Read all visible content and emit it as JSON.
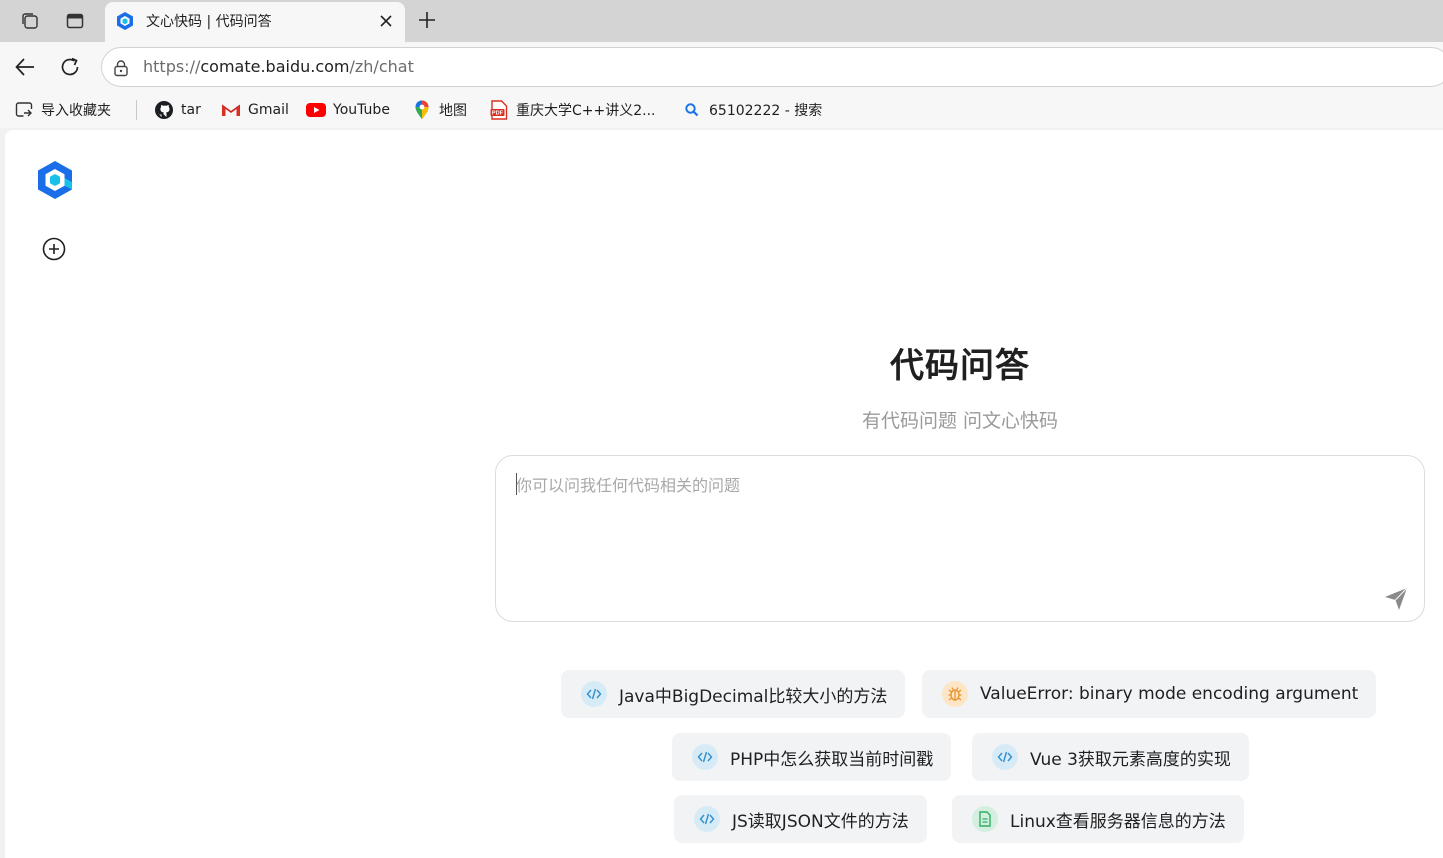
{
  "browser": {
    "tab": {
      "title": "文心快码 | 代码问答"
    },
    "address": {
      "scheme": "https://",
      "host": "comate.baidu.com",
      "path": "/zh/chat"
    },
    "bookmarks": [
      {
        "label": "导入收藏夹",
        "icon": "import-favorites-icon"
      },
      {
        "label": "tar",
        "icon": "github-icon"
      },
      {
        "label": "Gmail",
        "icon": "gmail-icon"
      },
      {
        "label": "YouTube",
        "icon": "youtube-icon"
      },
      {
        "label": "地图",
        "icon": "map-pin-icon"
      },
      {
        "label": "重庆大学C++讲义2...",
        "icon": "pdf-icon"
      },
      {
        "label": "65102222 - 搜索",
        "icon": "search-icon"
      }
    ]
  },
  "app": {
    "title": "代码问答",
    "subtitle": "有代码问题 问文心快码",
    "prompt": {
      "placeholder": "你可以问我任何代码相关的问题",
      "value": ""
    },
    "suggestions": [
      {
        "label": "Java中BigDecimal比较大小的方法",
        "icon": "code-icon"
      },
      {
        "label": "ValueError: binary mode encoding argument",
        "icon": "bug-icon"
      },
      {
        "label": "PHP中怎么获取当前时间戳",
        "icon": "code-icon"
      },
      {
        "label": "Vue 3获取元素高度的实现",
        "icon": "code-icon"
      },
      {
        "label": "JS读取JSON文件的方法",
        "icon": "code-icon"
      },
      {
        "label": "Linux查看服务器信息的方法",
        "icon": "document-icon"
      }
    ]
  },
  "colors": {
    "brand_blue": "#1a6fe8",
    "brand_cyan": "#19c1e8",
    "youtube_red": "#ff0000",
    "code_icon_blue": "#2f8fcf",
    "bug_icon_orange": "#e8922c",
    "doc_icon_green": "#2fae62"
  }
}
